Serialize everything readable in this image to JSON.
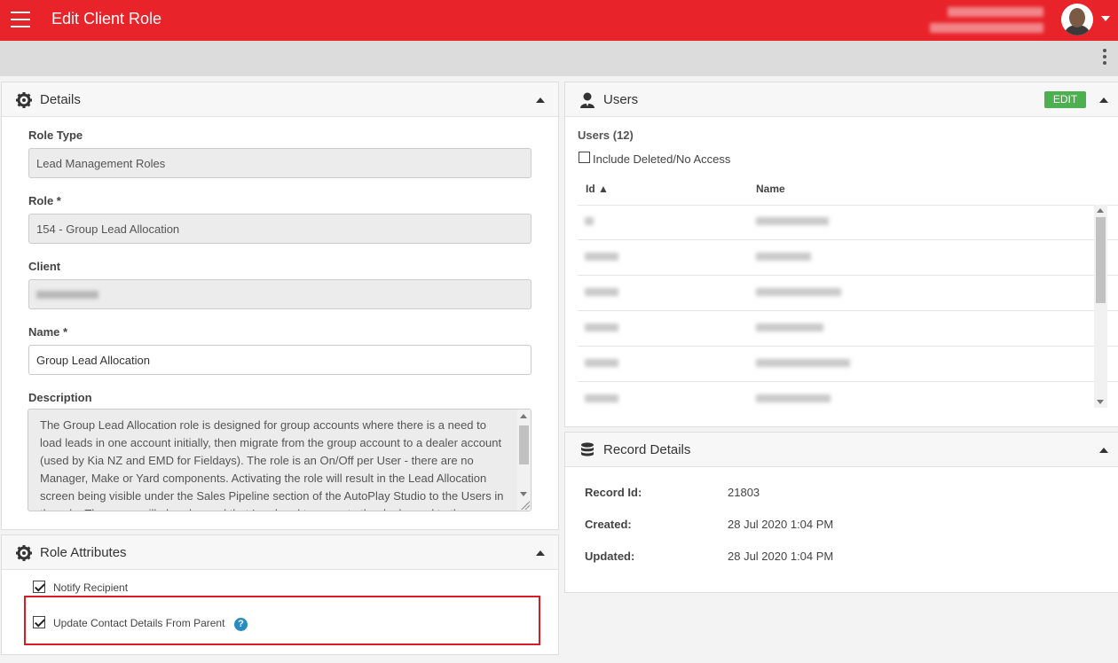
{
  "header": {
    "title": "Edit Client Role",
    "accent": "#e8232a"
  },
  "details": {
    "title": "Details",
    "role_type_label": "Role Type",
    "role_type_value": "Lead Management Roles",
    "role_label": "Role *",
    "role_value": "154 - Group Lead Allocation",
    "client_label": "Client",
    "name_label": "Name *",
    "name_value": "Group Lead Allocation",
    "description_label": "Description",
    "description_value": "The Group Lead Allocation role is designed for group accounts where there is a need to load leads in one account initially, then migrate from the group account to a dealer account (used by Kia NZ and EMD for Fieldays). The role is an On/Off per User - there are no Manager, Make or Yard components. Activating the role will result in the Lead Allocation screen being visible under the Sales Pipeline section of the AutoPlay Studio to the Users in the role. The group will already need that Lead and to move to the dealer and to the"
  },
  "role_attributes": {
    "title": "Role Attributes",
    "notify_recipient_label": "Notify Recipient",
    "notify_recipient_checked": true,
    "update_contact_label": "Update Contact Details From Parent",
    "update_contact_checked": true,
    "help_glyph": "?"
  },
  "users": {
    "title": "Users",
    "edit_label": "EDIT",
    "count_label": "Users (12)",
    "include_deleted_label": "Include Deleted/No Access",
    "include_deleted_checked": false,
    "columns": [
      "Id ▲",
      "Name"
    ]
  },
  "record_details": {
    "title": "Record Details",
    "record_id_label": "Record Id:",
    "record_id_value": "21803",
    "created_label": "Created:",
    "created_value": "28 Jul 2020 1:04 PM",
    "updated_label": "Updated:",
    "updated_value": "28 Jul 2020 1:04 PM"
  },
  "icons": [
    "menu-icon",
    "gear-icon",
    "user-icon",
    "database-icon",
    "collapse-icon",
    "kebab-icon",
    "help-icon"
  ]
}
